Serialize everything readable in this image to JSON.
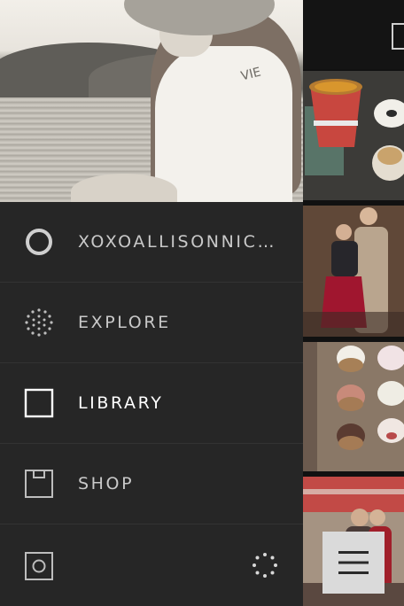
{
  "menu": {
    "items": [
      {
        "label": "XOXOALLISONNIC…",
        "icon": "profile-circle-icon"
      },
      {
        "label": "EXPLORE",
        "icon": "explore-dots-icon"
      },
      {
        "label": "LIBRARY",
        "icon": "library-square-icon"
      },
      {
        "label": "SHOP",
        "icon": "shop-box-icon"
      }
    ]
  },
  "profile_photo_shirt_text": "VIE",
  "colors": {
    "active_label": "#ffffff",
    "inactive_label": "#c9c9c9",
    "drawer_bg": "#262626"
  }
}
